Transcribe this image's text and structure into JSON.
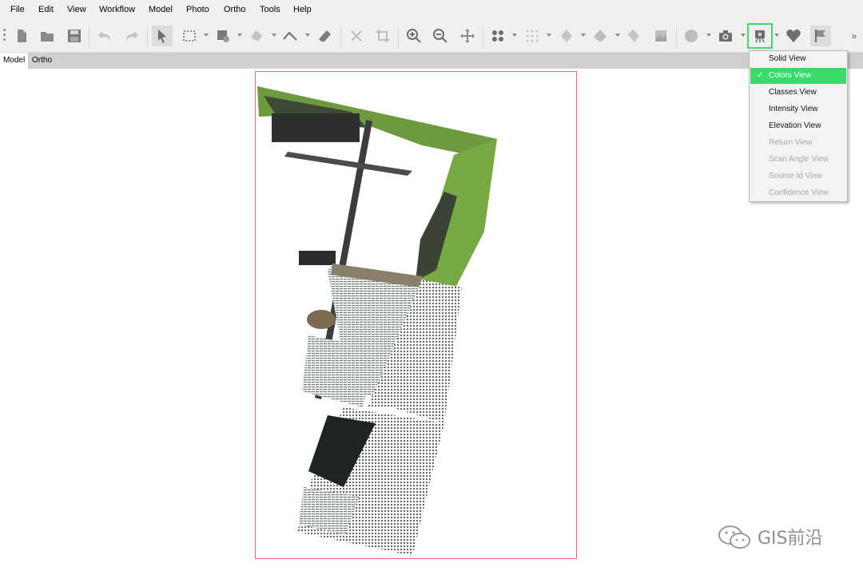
{
  "menu": [
    "File",
    "Edit",
    "View",
    "Workflow",
    "Model",
    "Photo",
    "Ortho",
    "Tools",
    "Help"
  ],
  "tabs": [
    "Model",
    "Ortho"
  ],
  "view_dropdown": {
    "items": [
      {
        "label": "Solid View",
        "enabled": true,
        "selected": false
      },
      {
        "label": "Colors View",
        "enabled": true,
        "selected": true
      },
      {
        "label": "Classes View",
        "enabled": true,
        "selected": false
      },
      {
        "label": "Intensity View",
        "enabled": true,
        "selected": false
      },
      {
        "label": "Elevation View",
        "enabled": true,
        "selected": false
      },
      {
        "label": "Return View",
        "enabled": false,
        "selected": false
      },
      {
        "label": "Scan Angle View",
        "enabled": false,
        "selected": false
      },
      {
        "label": "Source Id View",
        "enabled": false,
        "selected": false
      },
      {
        "label": "Confidence View",
        "enabled": false,
        "selected": false
      }
    ]
  },
  "watermark": "GIS前沿",
  "colors": {
    "accent_green": "#37db6a",
    "frame_red": "#e36b6b"
  }
}
